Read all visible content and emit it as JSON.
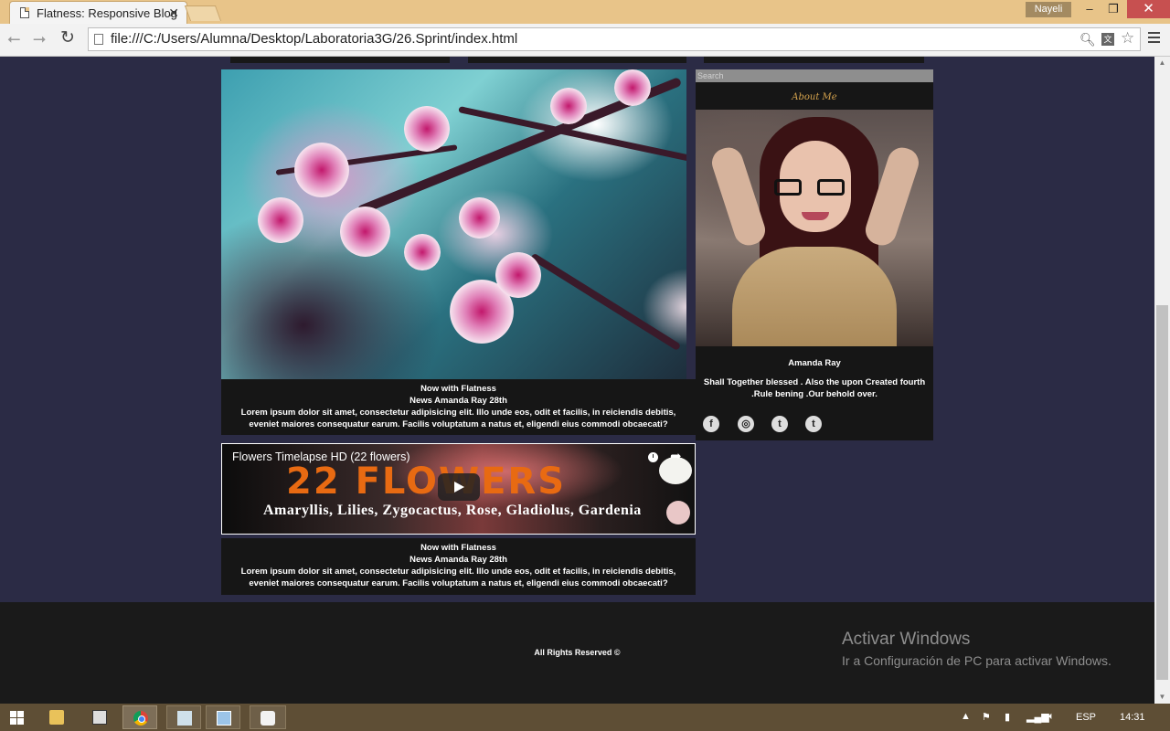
{
  "browser": {
    "tab_title": "Flatness: Responsive Blog",
    "tab_close": "✕",
    "user_badge": "Nayeli",
    "url": "file:///C:/Users/Alumna/Desktop/Laboratoria3G/26.Sprint/index.html",
    "window_min": "‒",
    "window_max": "❐",
    "window_close": "✕"
  },
  "posts": [
    {
      "title": "Now with Flatness",
      "meta": "News Amanda Ray 28th",
      "body": "Lorem ipsum dolor sit amet, consectetur adipisicing elit. Illo unde eos, odit et facilis, in reiciendis debitis, eveniet maiores consequatur earum. Facilis voluptatum a natus et, eligendi eius commodi obcaecati?"
    },
    {
      "title": "Now with Flatness",
      "meta": "News Amanda Ray 28th",
      "body": "Lorem ipsum dolor sit amet, consectetur adipisicing elit. Illo unde eos, odit et facilis, in reiciendis debitis, eveniet maiores consequatur earum. Facilis voluptatum a natus et, eligendi eius commodi obcaecati?"
    }
  ],
  "video": {
    "title": "Flowers Timelapse HD (22 flowers)",
    "overlay_title": "22 FLOWERS",
    "overlay_subtitle": "Amaryllis, Lilies, Zygocactus, Rose, Gladiolus, Gardenia"
  },
  "sidebar": {
    "search_placeholder": "Search",
    "about_heading": "About Me",
    "profile_name": "Amanda Ray",
    "profile_bio": "Shall Together blessed . Also the upon Created fourth .Rule bening .Our behold over.",
    "social": [
      "f",
      "◎",
      "t",
      "t"
    ]
  },
  "footer": {
    "text": "All Rights Reserved ©"
  },
  "watermark": {
    "title": "Activar Windows",
    "subtitle": "Ir a Configuración de PC para activar Windows."
  },
  "taskbar": {
    "language": "ESP",
    "clock": "14:31"
  },
  "colors": {
    "page_background": "#2b2b45",
    "panel": "#161616",
    "accent": "#d4a24d",
    "browser_frame": "#e8c489"
  }
}
